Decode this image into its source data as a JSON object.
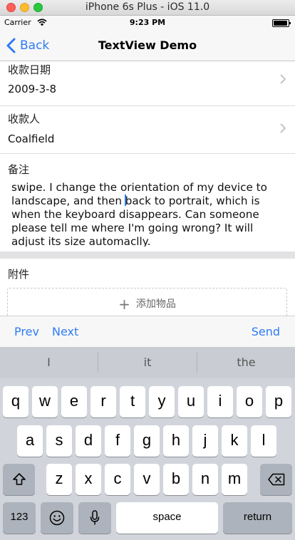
{
  "window": {
    "title": "iPhone 6s Plus - iOS 11.0"
  },
  "status": {
    "carrier": "Carrier",
    "time": "9:23 PM"
  },
  "nav": {
    "back_label": "Back",
    "title": "TextView Demo"
  },
  "form": {
    "date": {
      "label": "收款日期",
      "value": "2009-3-8"
    },
    "payee": {
      "label": "收款人",
      "value": "Coalfield"
    },
    "notes": {
      "label": "备注",
      "text_before_caret": "swipe. I change the orientation of my device to landscape, and then ",
      "text_after_caret": "back to portrait, which is when the keyboard disappears. Can someone please tell me where I'm going wrong? It will adjust its size automaclly."
    },
    "attachments": {
      "label": "附件",
      "add_label": "添加物品"
    }
  },
  "accessory": {
    "prev": "Prev",
    "next": "Next",
    "send": "Send"
  },
  "keyboard": {
    "suggestions": [
      "I",
      "it",
      "the"
    ],
    "row1": [
      "q",
      "w",
      "e",
      "r",
      "t",
      "y",
      "u",
      "i",
      "o",
      "p"
    ],
    "row2": [
      "a",
      "s",
      "d",
      "f",
      "g",
      "h",
      "j",
      "k",
      "l"
    ],
    "row3": [
      "z",
      "x",
      "c",
      "v",
      "b",
      "n",
      "m"
    ],
    "numbers_label": "123",
    "space_label": "space",
    "return_label": "return"
  },
  "colors": {
    "accent": "#2f7bf5",
    "keyboard_bg": "#d1d5db"
  }
}
